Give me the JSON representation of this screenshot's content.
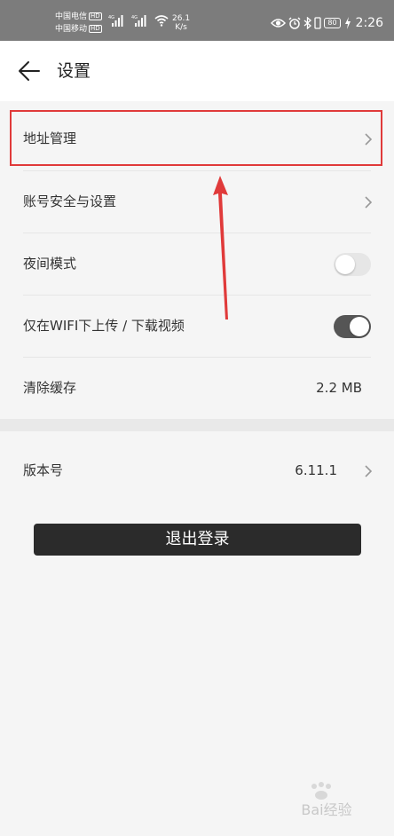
{
  "status_bar": {
    "carrier1": "中国电信",
    "carrier2": "中国移动",
    "hd_badge": "HD",
    "net_speed_value": "26.1",
    "net_speed_unit": "K/s",
    "battery": "80",
    "time": "2:26",
    "background_color": "#7c7c7c"
  },
  "header": {
    "title": "设置"
  },
  "settings": {
    "address": {
      "label": "地址管理"
    },
    "account": {
      "label": "账号安全与设置"
    },
    "night_mode": {
      "label": "夜间模式",
      "enabled": false
    },
    "wifi_only": {
      "label": "仅在WIFI下上传 / 下载视频",
      "enabled": true
    },
    "clear_cache": {
      "label": "清除缓存",
      "value": "2.2 MB"
    },
    "version": {
      "label": "版本号",
      "value": "6.11.1"
    }
  },
  "logout_button": {
    "label": "退出登录"
  },
  "annotation": {
    "color": "#e03a3a"
  },
  "watermark": {
    "text": "Bai经验"
  }
}
